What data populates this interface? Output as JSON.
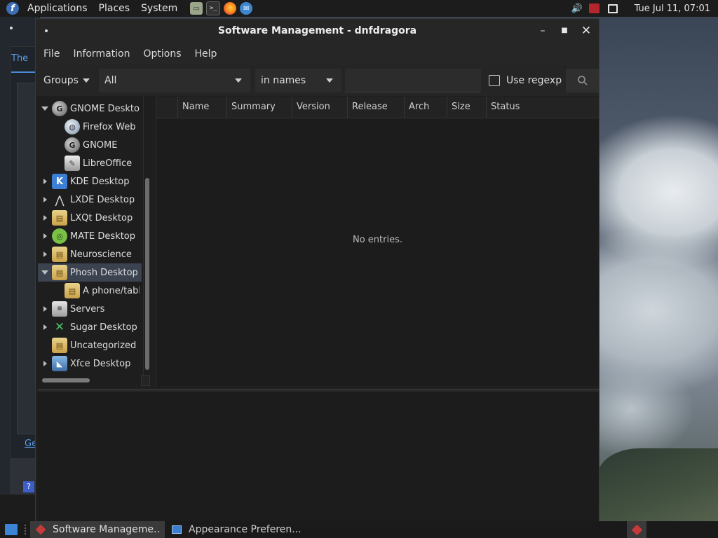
{
  "top_panel": {
    "menus": [
      "Applications",
      "Places",
      "System"
    ],
    "launchers": [
      "files-icon",
      "terminal-icon",
      "firefox-icon",
      "thunderbird-icon"
    ],
    "tray_icons": [
      "volume-icon",
      "updates-icon",
      "network-icon"
    ],
    "clock": "Tue Jul 11, 07:01"
  },
  "background_window": {
    "tab_label": "The",
    "link_label": "Ge",
    "help_label": "?"
  },
  "window": {
    "title": "Software Management - dnfdragora",
    "menubar": [
      "File",
      "Information",
      "Options",
      "Help"
    ],
    "toolbar": {
      "groups_label": "Groups",
      "filter_value": "All",
      "scope_value": "in names",
      "search_value": "",
      "regex_label": "Use regexp",
      "regex_checked": false
    },
    "groups": [
      {
        "label": "GNOME Desktop",
        "level": 0,
        "expander": "expanded",
        "icon": "gnome-icon"
      },
      {
        "label": "Firefox Web",
        "level": 1,
        "expander": "none",
        "icon": "globe-icon"
      },
      {
        "label": "GNOME",
        "level": 1,
        "expander": "none",
        "icon": "gnome-icon"
      },
      {
        "label": "LibreOffice",
        "level": 1,
        "expander": "none",
        "icon": "brush-icon"
      },
      {
        "label": "KDE Desktop",
        "level": 0,
        "expander": "collapsed",
        "icon": "kde-icon"
      },
      {
        "label": "LXDE Desktop",
        "level": 0,
        "expander": "collapsed",
        "icon": "lxde-icon"
      },
      {
        "label": "LXQt Desktop",
        "level": 0,
        "expander": "collapsed",
        "icon": "package-icon"
      },
      {
        "label": "MATE Desktop",
        "level": 0,
        "expander": "collapsed",
        "icon": "mate-icon"
      },
      {
        "label": "Neuroscience",
        "level": 0,
        "expander": "collapsed",
        "icon": "package-icon"
      },
      {
        "label": "Phosh Desktop",
        "level": 0,
        "expander": "expanded",
        "icon": "package-icon",
        "selected": true
      },
      {
        "label": "A phone/tabl",
        "level": 1,
        "expander": "none",
        "icon": "package-icon"
      },
      {
        "label": "Servers",
        "level": 0,
        "expander": "collapsed",
        "icon": "server-icon"
      },
      {
        "label": "Sugar Desktop E",
        "level": 0,
        "expander": "collapsed",
        "icon": "sugar-icon"
      },
      {
        "label": "Uncategorized",
        "level": 0,
        "expander": "none",
        "icon": "package-icon"
      },
      {
        "label": "Xfce Desktop",
        "level": 0,
        "expander": "collapsed",
        "icon": "xfce-icon"
      }
    ],
    "columns": [
      "Name",
      "Summary",
      "Version",
      "Release",
      "Arch",
      "Size",
      "Status"
    ],
    "empty_message": "No entries."
  },
  "taskbar": {
    "tasks": [
      {
        "label": "Software Manageme...",
        "active": true,
        "icon": "dnfdragora-icon"
      },
      {
        "label": "Appearance Preferen...",
        "active": false,
        "icon": "appearance-icon"
      }
    ]
  },
  "colors": {
    "accent": "#3c84d6",
    "selection": "#3b4250",
    "dnfdragora": "#c73a3a"
  }
}
